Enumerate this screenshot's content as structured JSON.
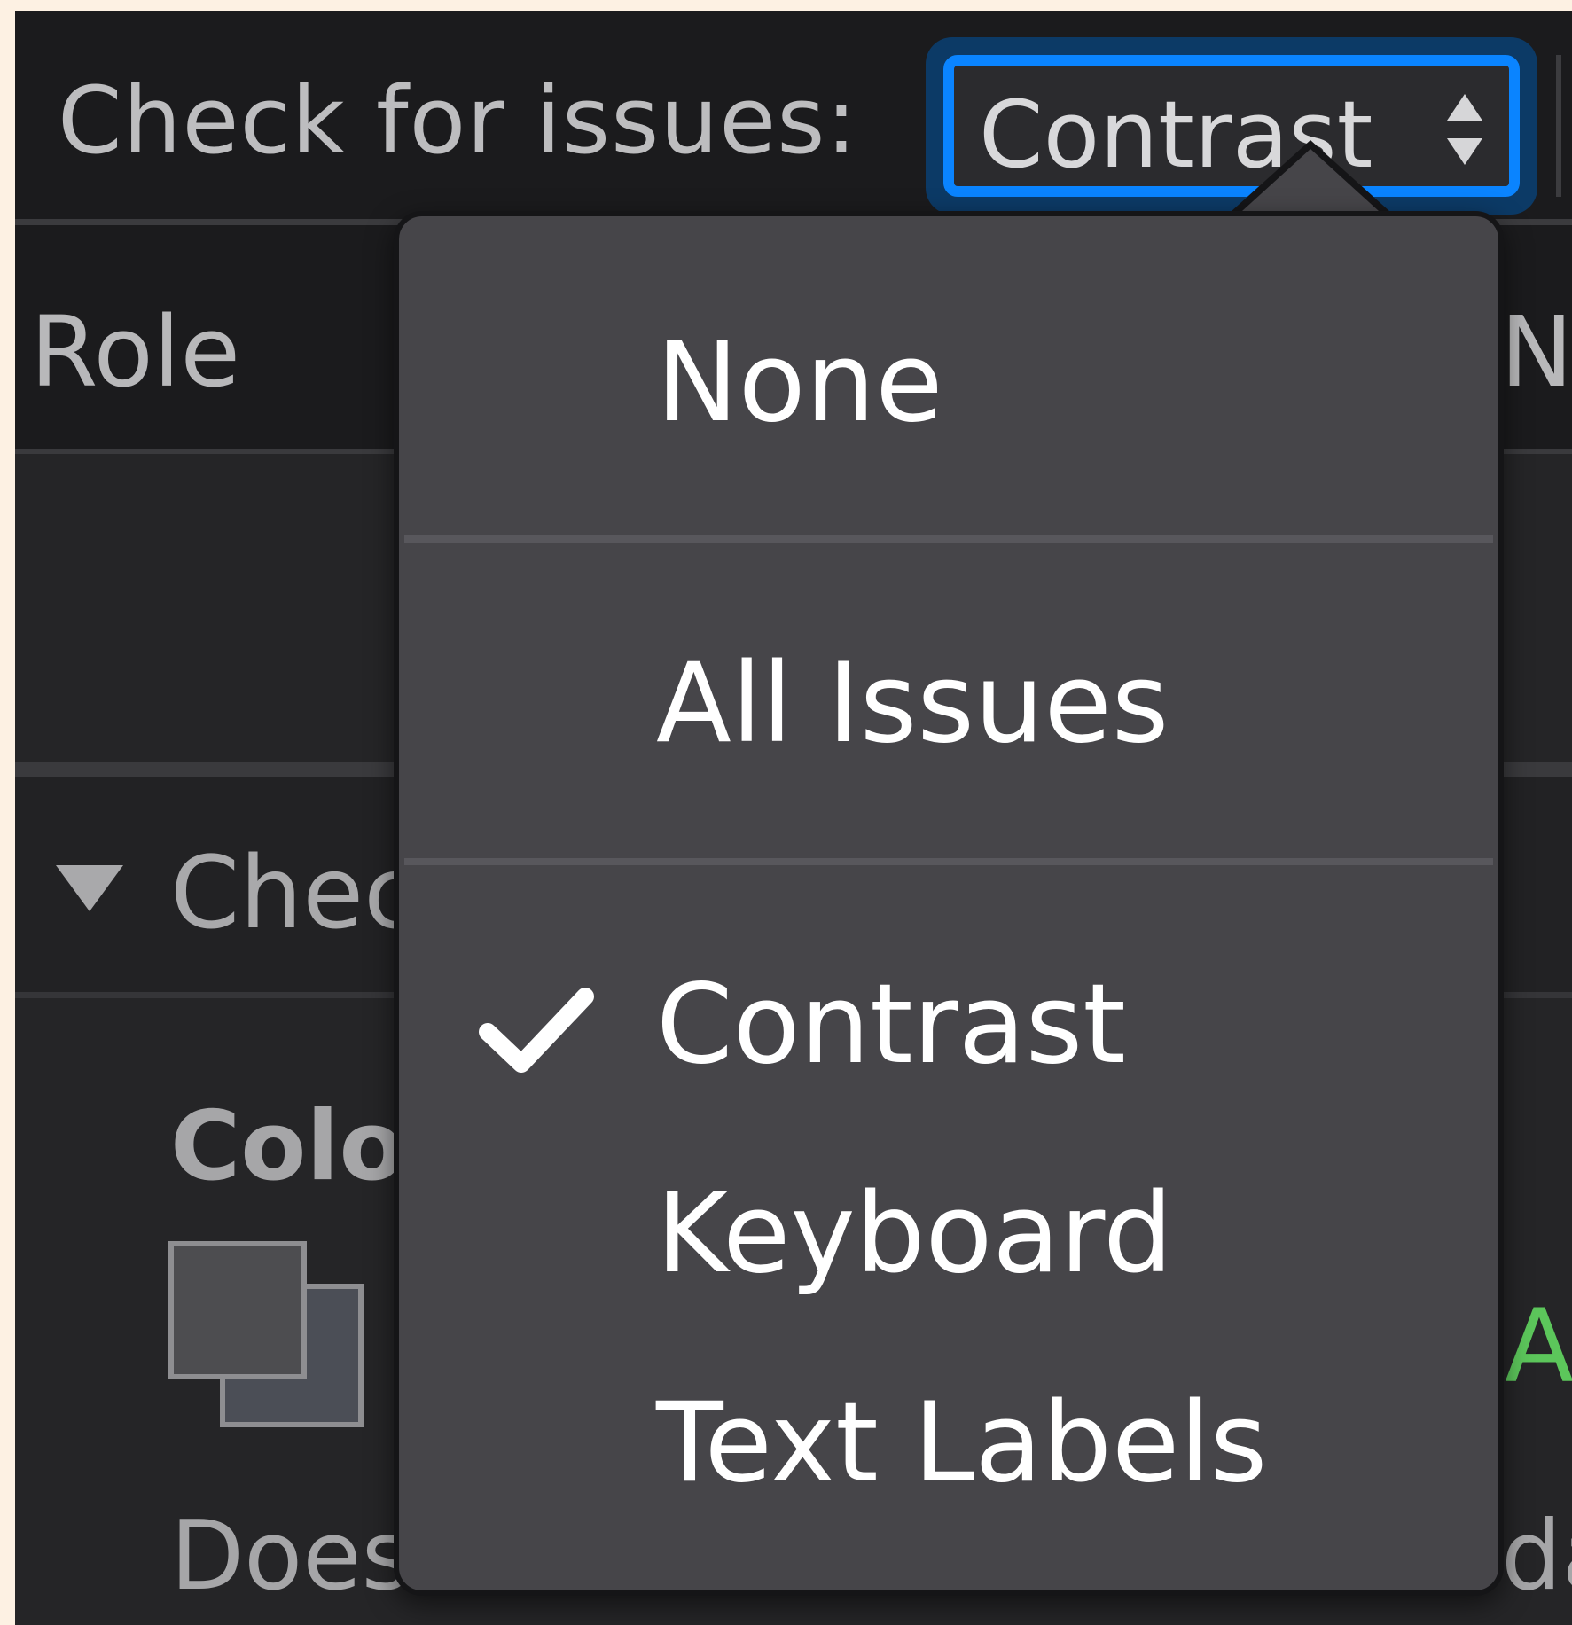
{
  "toolbar": {
    "check_label": "Check for issues:",
    "select_value": "Contrast"
  },
  "table": {
    "columns": [
      "Role",
      "Na"
    ],
    "group_label": "Chec",
    "detail_title": "Colo",
    "detail_text": "Does",
    "right_letter": "A",
    "right_text": "da"
  },
  "menu": {
    "items": [
      {
        "label": "None",
        "checked": false
      },
      {
        "label": "All Issues",
        "checked": false
      },
      {
        "label": "Contrast",
        "checked": true
      },
      {
        "label": "Keyboard",
        "checked": false
      },
      {
        "label": "Text Labels",
        "checked": false
      }
    ]
  },
  "icons": {
    "stepper": "up-down-chevron-icon",
    "disclosure": "disclosure-triangle-icon",
    "swatch": "color-swatch-icon",
    "check": "checkmark-icon"
  },
  "colors": {
    "accent": "#0a84ff",
    "menu_bg": "#464549",
    "pass_green": "#5cc65b"
  }
}
